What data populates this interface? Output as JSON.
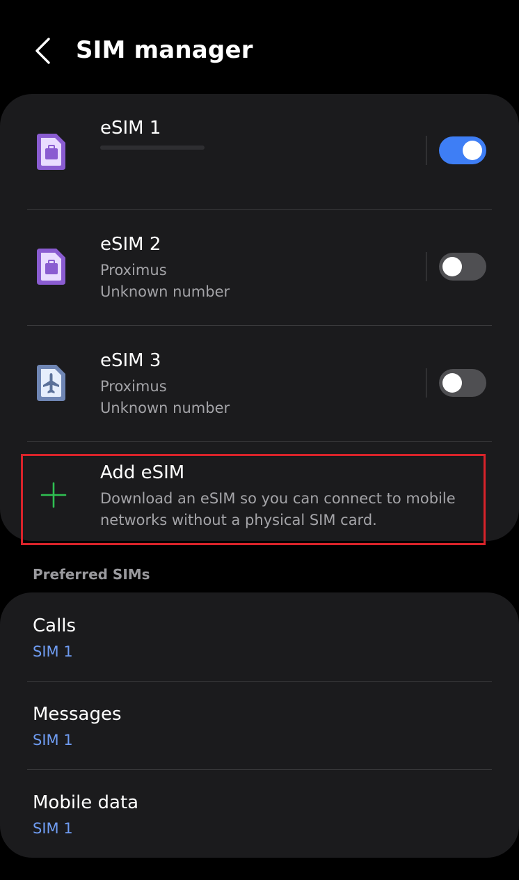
{
  "header": {
    "title": "SIM manager",
    "back_icon": "chevron-left-icon"
  },
  "sims": [
    {
      "name": "eSIM 1",
      "carrier": "",
      "number": "",
      "icon": "sim-work-icon",
      "icon_color": "#8a5cd1",
      "enabled": true
    },
    {
      "name": "eSIM 2",
      "carrier": "Proximus",
      "number": "Unknown number",
      "icon": "sim-work-icon",
      "icon_color": "#8a5cd1",
      "enabled": false
    },
    {
      "name": "eSIM 3",
      "carrier": "Proximus",
      "number": "Unknown number",
      "icon": "sim-airplane-icon",
      "icon_color": "#6f86b4",
      "enabled": false
    }
  ],
  "add_esim": {
    "title": "Add eSIM",
    "description": "Download an eSIM so you can connect to mobile networks without a physical SIM card.",
    "icon": "plus-icon",
    "icon_color": "#2fbf52",
    "highlight_color": "#d8232a"
  },
  "preferred": {
    "section_label": "Preferred SIMs",
    "items": [
      {
        "label": "Calls",
        "value": "SIM 1"
      },
      {
        "label": "Messages",
        "value": "SIM 1"
      },
      {
        "label": "Mobile data",
        "value": "SIM 1"
      }
    ]
  },
  "colors": {
    "accent": "#3e7ef5",
    "link": "#6f9cf2",
    "card": "#1b1b1d",
    "background": "#000000"
  }
}
